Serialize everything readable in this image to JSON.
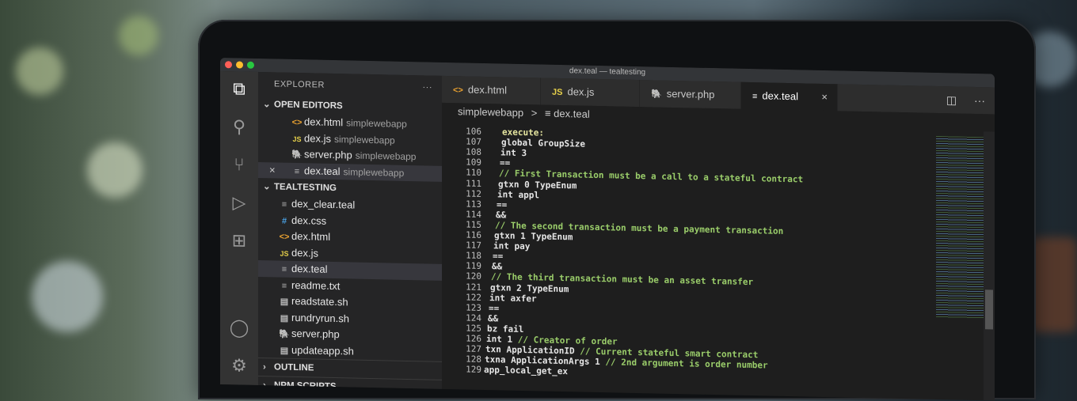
{
  "window_title": "dex.teal — tealtesting",
  "explorer": {
    "title": "EXPLORER",
    "more": "···",
    "open_editors_label": "OPEN EDITORS",
    "open_editors": [
      {
        "icon": "<>",
        "name": "dex.html",
        "folder": "simplewebapp"
      },
      {
        "icon": "JS",
        "name": "dex.js",
        "folder": "simplewebapp"
      },
      {
        "icon": "🐘",
        "name": "server.php",
        "folder": "simplewebapp"
      },
      {
        "icon": "≡",
        "name": "dex.teal",
        "folder": "simplewebapp",
        "close": "×"
      }
    ],
    "project_label": "TEALTESTING",
    "files": [
      {
        "icon": "≡",
        "name": "dex_clear.teal"
      },
      {
        "icon": "#",
        "name": "dex.css"
      },
      {
        "icon": "<>",
        "name": "dex.html"
      },
      {
        "icon": "JS",
        "name": "dex.js"
      },
      {
        "icon": "≡",
        "name": "dex.teal"
      },
      {
        "icon": "≡",
        "name": "readme.txt"
      },
      {
        "icon": "▤",
        "name": "readstate.sh"
      },
      {
        "icon": "▤",
        "name": "rundryrun.sh"
      },
      {
        "icon": "🐘",
        "name": "server.php"
      },
      {
        "icon": "▤",
        "name": "updateapp.sh"
      }
    ],
    "outline_label": "OUTLINE",
    "npm_label": "NPM SCRIPTS"
  },
  "tabs": [
    {
      "icon": "<>",
      "label": "dex.html"
    },
    {
      "icon": "JS",
      "label": "dex.js"
    },
    {
      "icon": "🐘",
      "label": "server.php"
    },
    {
      "icon": "≡",
      "label": "dex.teal",
      "close": "×"
    }
  ],
  "tab_tools": {
    "split": "◫",
    "more": "···"
  },
  "breadcrumb": {
    "folder": "simplewebapp",
    "sep": ">",
    "file_icon": "≡",
    "file": "dex.teal"
  },
  "code_lines": [
    {
      "n": "106",
      "t": "execute:"
    },
    {
      "n": "107",
      "t": "global GroupSize"
    },
    {
      "n": "108",
      "t": "int 3"
    },
    {
      "n": "109",
      "t": "=="
    },
    {
      "n": "110",
      "t": "// First Transaction must be a call to a stateful contract"
    },
    {
      "n": "111",
      "t": "gtxn 0 TypeEnum"
    },
    {
      "n": "112",
      "t": "int appl"
    },
    {
      "n": "113",
      "t": "=="
    },
    {
      "n": "114",
      "t": "&&"
    },
    {
      "n": "115",
      "t": "// The second transaction must be a payment transaction"
    },
    {
      "n": "116",
      "t": "gtxn 1 TypeEnum"
    },
    {
      "n": "117",
      "t": "int pay"
    },
    {
      "n": "118",
      "t": "=="
    },
    {
      "n": "119",
      "t": "&&"
    },
    {
      "n": "120",
      "t": "// The third transaction must be an asset transfer"
    },
    {
      "n": "121",
      "t": "gtxn 2 TypeEnum"
    },
    {
      "n": "122",
      "t": "int axfer"
    },
    {
      "n": "123",
      "t": "=="
    },
    {
      "n": "124",
      "t": "&&"
    },
    {
      "n": "125",
      "t": "bz fail"
    },
    {
      "n": "126",
      "t": "int 1 // Creator of order"
    },
    {
      "n": "127",
      "t": "txn ApplicationID // Current stateful smart contract"
    },
    {
      "n": "128",
      "t": "txna ApplicationArgs 1 // 2nd argument is order number"
    },
    {
      "n": "129",
      "t": "app_local_get_ex"
    }
  ],
  "colors": {
    "sidebar": "#252526",
    "editor": "#1e1e1e",
    "activity": "#333333",
    "comment": "#6a9955",
    "keyword": "#569cd6"
  }
}
